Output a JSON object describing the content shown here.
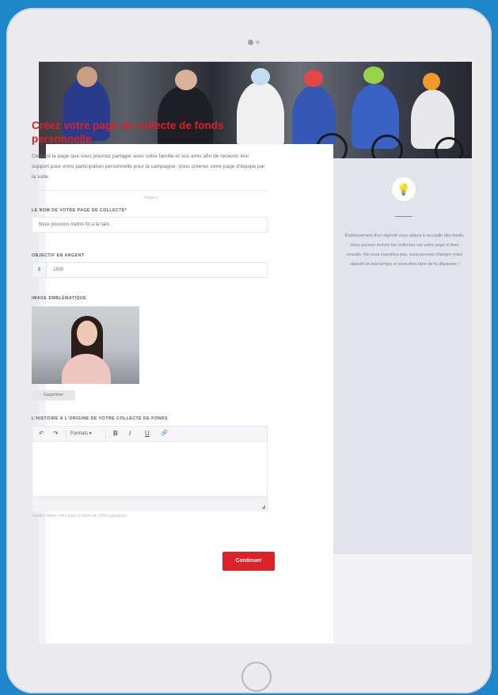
{
  "form": {
    "title": "Créez votre page de collecte de fonds personnelle",
    "intro": "Ceci est la page que vous pourrez partager avec votre famille et vos amis afin de recevoir leur support pour votre participation personnelle pour la campagne. Vous créerez votre page d'équipe par la suite.",
    "step": "Étape 1",
    "name_label": "LE NOM DE VOTRE PAGE DE COLLECTE*",
    "name_value": "Nous pouvons mettre fin à la faim",
    "goal_label": "OBJECTIF EN ARGENT",
    "currency": "$",
    "goal_value": "1500",
    "image_label": "IMAGE EMBLÉMATIQUE",
    "remove_label": "Supprimer",
    "story_label": "L'HISTOIRE À L'ORIGINE DE VOTRE COLLECTE DE FONDS",
    "format_label": "Formats ▾",
    "hint": "Veuillez limiter votre texte à moins de 1500 caractères.",
    "continue_label": "Continuer"
  },
  "sidebar": {
    "bulb_icon": "lightbulb-icon",
    "tip": "Établissement d'un objectif vous aidera à recueillir des fonds. Vous pouvez inclure les collectes sur votre page si bien ensuite. Ne vous inquiétez pas, vous pouvez changer votre objectif en tout temps et vous êtes libre de le dépasser !"
  },
  "toolbar": {
    "undo_icon": "↶",
    "redo_icon": "↷",
    "bold": "B",
    "italic": "I",
    "underline": "U",
    "link_icon": "🔗"
  },
  "colors": {
    "accent": "#dc2128",
    "background": "#1d87c9"
  }
}
